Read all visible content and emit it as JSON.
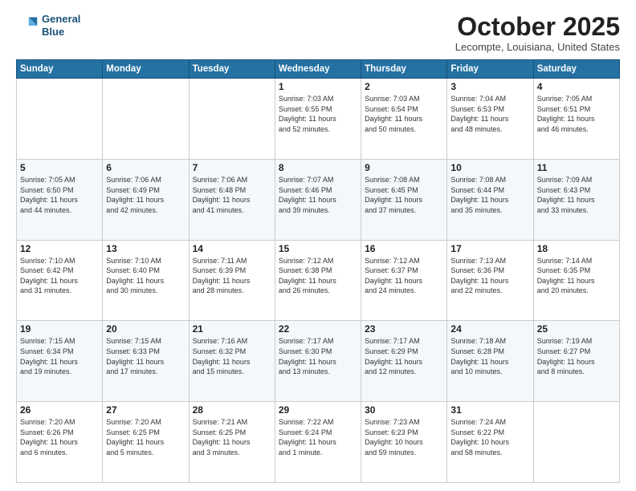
{
  "header": {
    "logo_line1": "General",
    "logo_line2": "Blue",
    "month": "October 2025",
    "location": "Lecompte, Louisiana, United States"
  },
  "days_of_week": [
    "Sunday",
    "Monday",
    "Tuesday",
    "Wednesday",
    "Thursday",
    "Friday",
    "Saturday"
  ],
  "weeks": [
    [
      {
        "day": "",
        "info": ""
      },
      {
        "day": "",
        "info": ""
      },
      {
        "day": "",
        "info": ""
      },
      {
        "day": "1",
        "info": "Sunrise: 7:03 AM\nSunset: 6:55 PM\nDaylight: 11 hours\nand 52 minutes."
      },
      {
        "day": "2",
        "info": "Sunrise: 7:03 AM\nSunset: 6:54 PM\nDaylight: 11 hours\nand 50 minutes."
      },
      {
        "day": "3",
        "info": "Sunrise: 7:04 AM\nSunset: 6:53 PM\nDaylight: 11 hours\nand 48 minutes."
      },
      {
        "day": "4",
        "info": "Sunrise: 7:05 AM\nSunset: 6:51 PM\nDaylight: 11 hours\nand 46 minutes."
      }
    ],
    [
      {
        "day": "5",
        "info": "Sunrise: 7:05 AM\nSunset: 6:50 PM\nDaylight: 11 hours\nand 44 minutes."
      },
      {
        "day": "6",
        "info": "Sunrise: 7:06 AM\nSunset: 6:49 PM\nDaylight: 11 hours\nand 42 minutes."
      },
      {
        "day": "7",
        "info": "Sunrise: 7:06 AM\nSunset: 6:48 PM\nDaylight: 11 hours\nand 41 minutes."
      },
      {
        "day": "8",
        "info": "Sunrise: 7:07 AM\nSunset: 6:46 PM\nDaylight: 11 hours\nand 39 minutes."
      },
      {
        "day": "9",
        "info": "Sunrise: 7:08 AM\nSunset: 6:45 PM\nDaylight: 11 hours\nand 37 minutes."
      },
      {
        "day": "10",
        "info": "Sunrise: 7:08 AM\nSunset: 6:44 PM\nDaylight: 11 hours\nand 35 minutes."
      },
      {
        "day": "11",
        "info": "Sunrise: 7:09 AM\nSunset: 6:43 PM\nDaylight: 11 hours\nand 33 minutes."
      }
    ],
    [
      {
        "day": "12",
        "info": "Sunrise: 7:10 AM\nSunset: 6:42 PM\nDaylight: 11 hours\nand 31 minutes."
      },
      {
        "day": "13",
        "info": "Sunrise: 7:10 AM\nSunset: 6:40 PM\nDaylight: 11 hours\nand 30 minutes."
      },
      {
        "day": "14",
        "info": "Sunrise: 7:11 AM\nSunset: 6:39 PM\nDaylight: 11 hours\nand 28 minutes."
      },
      {
        "day": "15",
        "info": "Sunrise: 7:12 AM\nSunset: 6:38 PM\nDaylight: 11 hours\nand 26 minutes."
      },
      {
        "day": "16",
        "info": "Sunrise: 7:12 AM\nSunset: 6:37 PM\nDaylight: 11 hours\nand 24 minutes."
      },
      {
        "day": "17",
        "info": "Sunrise: 7:13 AM\nSunset: 6:36 PM\nDaylight: 11 hours\nand 22 minutes."
      },
      {
        "day": "18",
        "info": "Sunrise: 7:14 AM\nSunset: 6:35 PM\nDaylight: 11 hours\nand 20 minutes."
      }
    ],
    [
      {
        "day": "19",
        "info": "Sunrise: 7:15 AM\nSunset: 6:34 PM\nDaylight: 11 hours\nand 19 minutes."
      },
      {
        "day": "20",
        "info": "Sunrise: 7:15 AM\nSunset: 6:33 PM\nDaylight: 11 hours\nand 17 minutes."
      },
      {
        "day": "21",
        "info": "Sunrise: 7:16 AM\nSunset: 6:32 PM\nDaylight: 11 hours\nand 15 minutes."
      },
      {
        "day": "22",
        "info": "Sunrise: 7:17 AM\nSunset: 6:30 PM\nDaylight: 11 hours\nand 13 minutes."
      },
      {
        "day": "23",
        "info": "Sunrise: 7:17 AM\nSunset: 6:29 PM\nDaylight: 11 hours\nand 12 minutes."
      },
      {
        "day": "24",
        "info": "Sunrise: 7:18 AM\nSunset: 6:28 PM\nDaylight: 11 hours\nand 10 minutes."
      },
      {
        "day": "25",
        "info": "Sunrise: 7:19 AM\nSunset: 6:27 PM\nDaylight: 11 hours\nand 8 minutes."
      }
    ],
    [
      {
        "day": "26",
        "info": "Sunrise: 7:20 AM\nSunset: 6:26 PM\nDaylight: 11 hours\nand 6 minutes."
      },
      {
        "day": "27",
        "info": "Sunrise: 7:20 AM\nSunset: 6:25 PM\nDaylight: 11 hours\nand 5 minutes."
      },
      {
        "day": "28",
        "info": "Sunrise: 7:21 AM\nSunset: 6:25 PM\nDaylight: 11 hours\nand 3 minutes."
      },
      {
        "day": "29",
        "info": "Sunrise: 7:22 AM\nSunset: 6:24 PM\nDaylight: 11 hours\nand 1 minute."
      },
      {
        "day": "30",
        "info": "Sunrise: 7:23 AM\nSunset: 6:23 PM\nDaylight: 10 hours\nand 59 minutes."
      },
      {
        "day": "31",
        "info": "Sunrise: 7:24 AM\nSunset: 6:22 PM\nDaylight: 10 hours\nand 58 minutes."
      },
      {
        "day": "",
        "info": ""
      }
    ]
  ]
}
